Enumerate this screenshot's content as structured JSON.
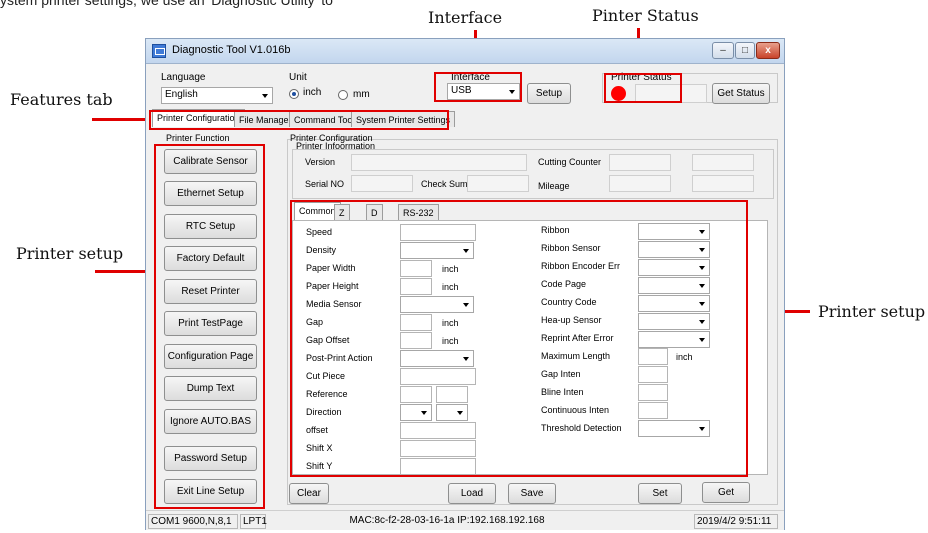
{
  "annotations": {
    "topcut": "ystem printer settings, we use an 'Diagnostic Utility' to",
    "interface": "Interface",
    "printer_status": "Pinter Status",
    "features_tab": "Features tab",
    "printer_setup_left": "Printer setup",
    "printer_setup_right": "Printer setup"
  },
  "window": {
    "title": "Diagnostic Tool V1.016b",
    "min": "–",
    "max": "□",
    "close": "x"
  },
  "top": {
    "language_label": "Language",
    "language_value": "English",
    "unit_label": "Unit",
    "unit_inch": "inch",
    "unit_mm": "mm",
    "interface_label": "Interface",
    "interface_value": "USB",
    "setup_button": "Setup",
    "printer_status_label": "Printer  Status",
    "get_status_button": "Get Status",
    "status_color": "#ff0000"
  },
  "tabs": [
    "Printer Configuration",
    "File Manager",
    "Command Tool",
    "System Printer Settings"
  ],
  "function_panel": {
    "title": "Printer  Function",
    "buttons": [
      "Calibrate Sensor",
      "Ethernet Setup",
      "RTC Setup",
      "Factory Default",
      "Reset Printer",
      "Print TestPage",
      "Configuration Page",
      "Dump Text",
      "Ignore AUTO.BAS",
      "Password Setup",
      "Exit Line Setup"
    ]
  },
  "config": {
    "title": "Printer Configuration",
    "info_title": "Printer Infoormation",
    "version": "Version",
    "cutting_counter": "Cutting Counter",
    "serial_no": "Serial NO",
    "check_sum": "Check Sum",
    "mileage": "Mileage"
  },
  "inner_tabs": [
    "Common",
    "Z",
    "D",
    "RS-232"
  ],
  "common_left": {
    "speed": "Speed",
    "density": "Density",
    "paper_width": "Paper Width",
    "paper_height": "Paper Height",
    "media_sensor": "Media Sensor",
    "gap": "Gap",
    "gap_offset": "Gap Offset",
    "post_print": "Post-Print  Action",
    "cut_piece": "Cut  Piece",
    "reference": "Reference",
    "direction": "Direction",
    "offset": "offset",
    "shift_x": "Shift X",
    "shift_y": "Shift Y",
    "unit_inch": "inch"
  },
  "common_right": {
    "ribbon": "Ribbon",
    "ribbon_sensor": "Ribbon  Sensor",
    "ribbon_encoder": "Ribbon Encoder Err",
    "code_page": "Code Page",
    "country_code": "Country Code",
    "head_up": "Hea-up  Sensor",
    "reprint": "Reprint After  Error",
    "max_length": "Maximum Length",
    "max_length_unit": "inch",
    "gap_inten": "Gap Inten",
    "bline_inten": "Bline  Inten",
    "continuous_inten": "Continuous  Inten",
    "threshold": "Threshold  Detection"
  },
  "bottom_buttons": {
    "clear": "Clear",
    "load": "Load",
    "save": "Save",
    "set": "Set",
    "get": "Get"
  },
  "statusbar": {
    "com": "COM1 9600,N,8,1",
    "lpt": "LPT1",
    "network": "MAC:8c-f2-28-03-16-1a   IP:192.168.192.168",
    "datetime": "2019/4/2  9:51:11"
  }
}
